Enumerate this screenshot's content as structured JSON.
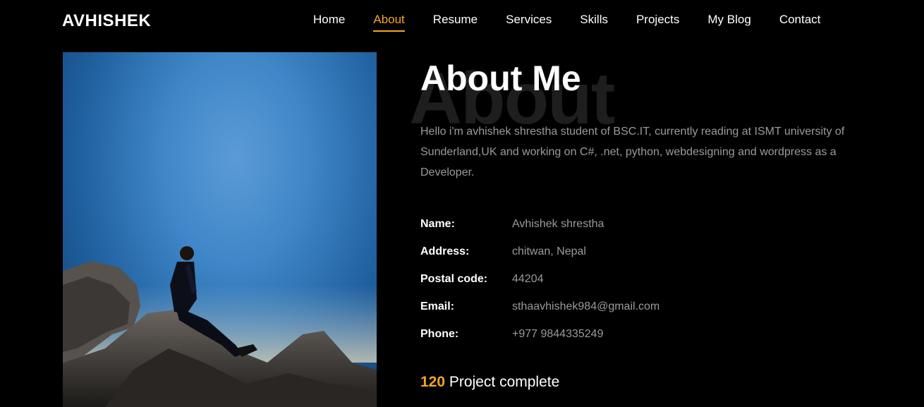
{
  "brand": {
    "logo": "AVHISHEK"
  },
  "nav": {
    "items": [
      {
        "label": "Home"
      },
      {
        "label": "About",
        "active": true
      },
      {
        "label": "Resume"
      },
      {
        "label": "Services"
      },
      {
        "label": "Skills"
      },
      {
        "label": "Projects"
      },
      {
        "label": "My Blog"
      },
      {
        "label": "Contact"
      }
    ]
  },
  "about": {
    "bg_word": "About",
    "title": "About Me",
    "intro": "Hello i'm avhishek shrestha student of BSC.IT, currently reading at ISMT university of Sunderland,UK and working on C#, .net, python, webdesigning and wordpress as a Developer.",
    "info": [
      {
        "label": "Name:",
        "value": "Avhishek shrestha"
      },
      {
        "label": "Address:",
        "value": "chitwan, Nepal"
      },
      {
        "label": "Postal code:",
        "value": "44204"
      },
      {
        "label": "Email:",
        "value": "sthaavhishek984@gmail.com"
      },
      {
        "label": "Phone:",
        "value": "+977 9844335249"
      }
    ],
    "stat": {
      "number": "120",
      "label": "Project complete"
    }
  },
  "colors": {
    "accent": "#f5a623",
    "background": "#000000",
    "muted_text": "#9a9a9a"
  }
}
